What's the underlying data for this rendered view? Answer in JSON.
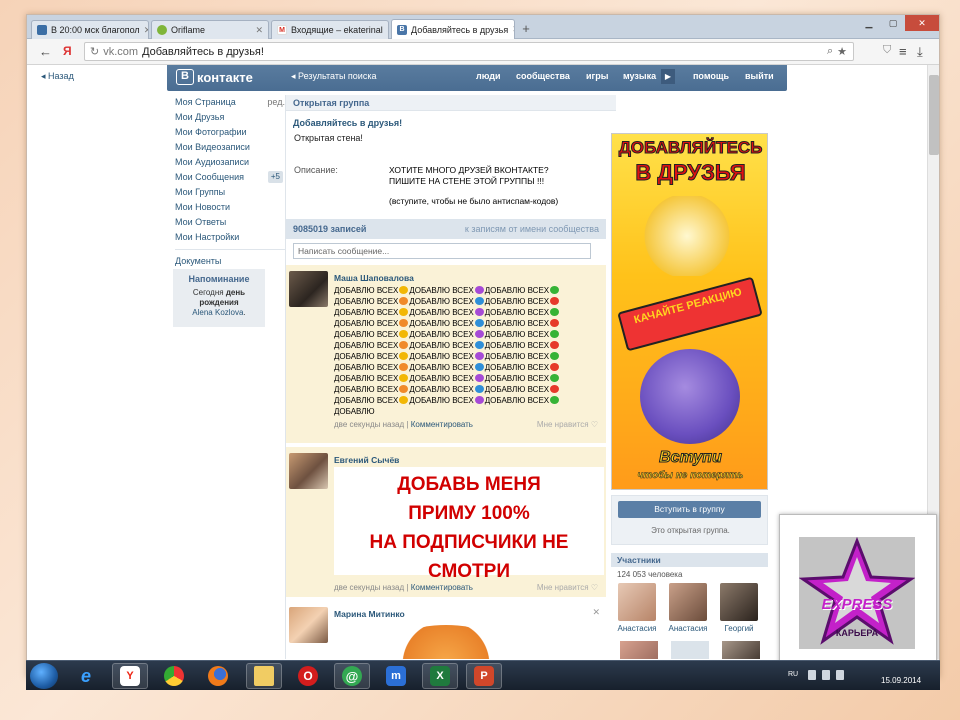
{
  "browser": {
    "tabs": [
      {
        "title": "В 20:00 мск благопол",
        "color": "#3b6ea5"
      },
      {
        "title": "Oriflame",
        "color": "#7fb539"
      },
      {
        "title": "Входящие – ekaterinal",
        "color": "#d93025"
      },
      {
        "title": "Добавляйтесь в друзья",
        "color": "#4a76a8"
      }
    ],
    "new_tab": "+",
    "yandex_icon": "Я",
    "url_host": "vk.com",
    "url_title": "Добавляйтесь в друзья!"
  },
  "vk": {
    "back": "Назад",
    "logo": "контакте",
    "logo_letter": "В",
    "search_results": "◂ Результаты поиска",
    "nav": [
      "люди",
      "сообщества",
      "игры",
      "музыка",
      "помощь",
      "выйти"
    ],
    "menu": [
      {
        "label": "Моя Страница",
        "extra": "ред."
      },
      {
        "label": "Мои Друзья",
        "extra": ""
      },
      {
        "label": "Мои Фотографии",
        "extra": ""
      },
      {
        "label": "Мои Видеозаписи",
        "extra": ""
      },
      {
        "label": "Мои Аудиозаписи",
        "extra": ""
      },
      {
        "label": "Мои Сообщения",
        "badge": "+5"
      },
      {
        "label": "Мои Группы",
        "extra": ""
      },
      {
        "label": "Мои Новости",
        "extra": ""
      },
      {
        "label": "Мои Ответы",
        "extra": ""
      },
      {
        "label": "Мои Настройки",
        "extra": ""
      }
    ],
    "documents": "Документы",
    "reminder": {
      "title": "Напоминание",
      "pre": "Сегодня",
      "bold": "день рождения",
      "name": "Alena Kozlova",
      "post": "."
    }
  },
  "group": {
    "kind": "Открытая группа",
    "title": "Добавляйтесь в друзья!",
    "status": "Открытая стена!",
    "desc_label": "Описание:",
    "desc_line1": "ХОТИТЕ МНОГО ДРУЗЕЙ ВКОНТАКТЕ?",
    "desc_line2": "ПИШИТЕ НА СТЕНЕ ЭТОЙ ГРУППЫ !!!",
    "desc_line3": "(вступите, чтобы не было антиспам-кодов)",
    "wall_count": "9085019 записей",
    "wall_filter": "к записям от имени сообщества",
    "wall_placeholder": "Написать сообщение...",
    "join_button": "Вступить в группу",
    "join_note": "Это открытая группа.",
    "members_title": "Участники",
    "members_count": "124 053 человека",
    "members": [
      "Анастасия",
      "Анастасия",
      "Георгий"
    ]
  },
  "posts": [
    {
      "author": "Маша Шаповалова",
      "time": "две секунды назад",
      "comment": "Комментировать",
      "like": "Мне нравится ♡",
      "word": "ДОБАВЛЮ ВСЕХ",
      "last": "ДОБАВЛЮ",
      "heart_colors": [
        "#f2b705",
        "#a64bd6",
        "#36b336",
        "#f08a2a",
        "#2f8fd8",
        "#e6392a"
      ]
    },
    {
      "author": "Евгений Сычёв",
      "time": "две секунды назад",
      "comment": "Комментировать",
      "like": "Мне нравится ♡",
      "big_lines": [
        "ДОБАВЬ МЕНЯ",
        "ПРИМУ 100%",
        "НА ПОДПИСЧИКИ НЕ",
        "СМОТРИ"
      ]
    },
    {
      "author": "Марина Митинко",
      "close": "✕"
    }
  ],
  "ad": {
    "line1": "ДОБАВЛЯЙТЕСЬ",
    "line2": "В ДРУЗЬЯ",
    "badge": "КАЧАЙТЕ РЕАКЦИЮ",
    "line3": "Вступи",
    "line4": "чтобы не потерять"
  },
  "overlay": {
    "word": "EXPRESS",
    "sub": "КАРЬЕРА"
  },
  "taskbar": {
    "lang": "RU",
    "time": "",
    "date": "15.09.2014"
  }
}
